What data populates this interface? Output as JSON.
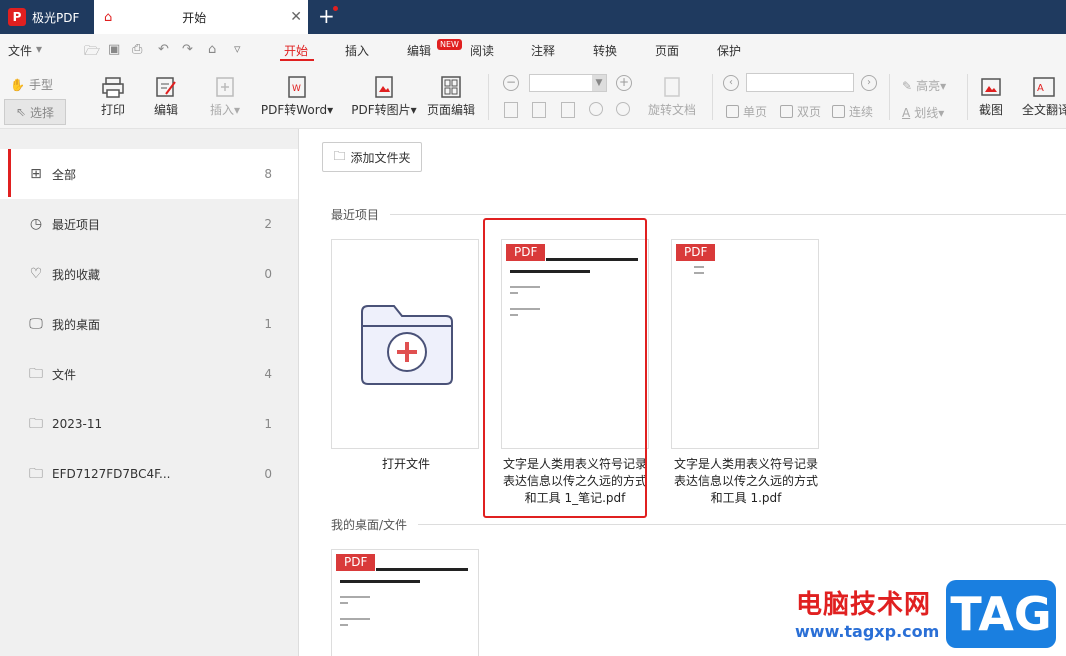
{
  "app": {
    "name": "极光PDF",
    "logo_letter": "P"
  },
  "tab": {
    "label": "开始",
    "close": "✕",
    "new": "+"
  },
  "menu": {
    "file": "文件",
    "items": [
      "开始",
      "插入",
      "编辑",
      "阅读",
      "注释",
      "转换",
      "页面",
      "保护"
    ],
    "new_badge": "NEW"
  },
  "toolbar": {
    "hand": "手型",
    "select": "选择",
    "print": "打印",
    "edit": "编辑",
    "insert": "插入",
    "pdf_to_word": "PDF转Word",
    "pdf_to_image": "PDF转图片",
    "page_edit": "页面编辑",
    "rotate": "旋转文档",
    "single": "单页",
    "double": "双页",
    "continuous": "连续",
    "highlight": "高亮",
    "underline": "划线",
    "screenshot": "截图",
    "translate": "全文翻译"
  },
  "sidebar": {
    "items": [
      {
        "label": "全部",
        "count": "8"
      },
      {
        "label": "最近项目",
        "count": "2"
      },
      {
        "label": "我的收藏",
        "count": "0"
      },
      {
        "label": "我的桌面",
        "count": "1"
      },
      {
        "label": "文件",
        "count": "4"
      },
      {
        "label": "2023-11",
        "count": "1"
      },
      {
        "label": "EFD7127FD7BC4F...",
        "count": "0"
      }
    ]
  },
  "main": {
    "add_folder": "添加文件夹",
    "recent_title": "最近项目",
    "desktop_title": "我的桌面/文件",
    "open_file": "打开文件",
    "pdf_badge": "PDF",
    "file1_line1": "文字是人类用表义符号记录",
    "file1_line2": "表达信息以传之久远的方式",
    "file1_line3": "和工具 1_笔记.pdf",
    "file2_line1": "文字是人类用表义符号记录",
    "file2_line2": "表达信息以传之久远的方式",
    "file2_line3": "和工具 1.pdf"
  },
  "watermark": {
    "text": "电脑技术网",
    "url": "www.tagxp.com",
    "tag": "TAG"
  },
  "colors": {
    "accent": "#e02020",
    "titlebar": "#1f3a5f"
  }
}
